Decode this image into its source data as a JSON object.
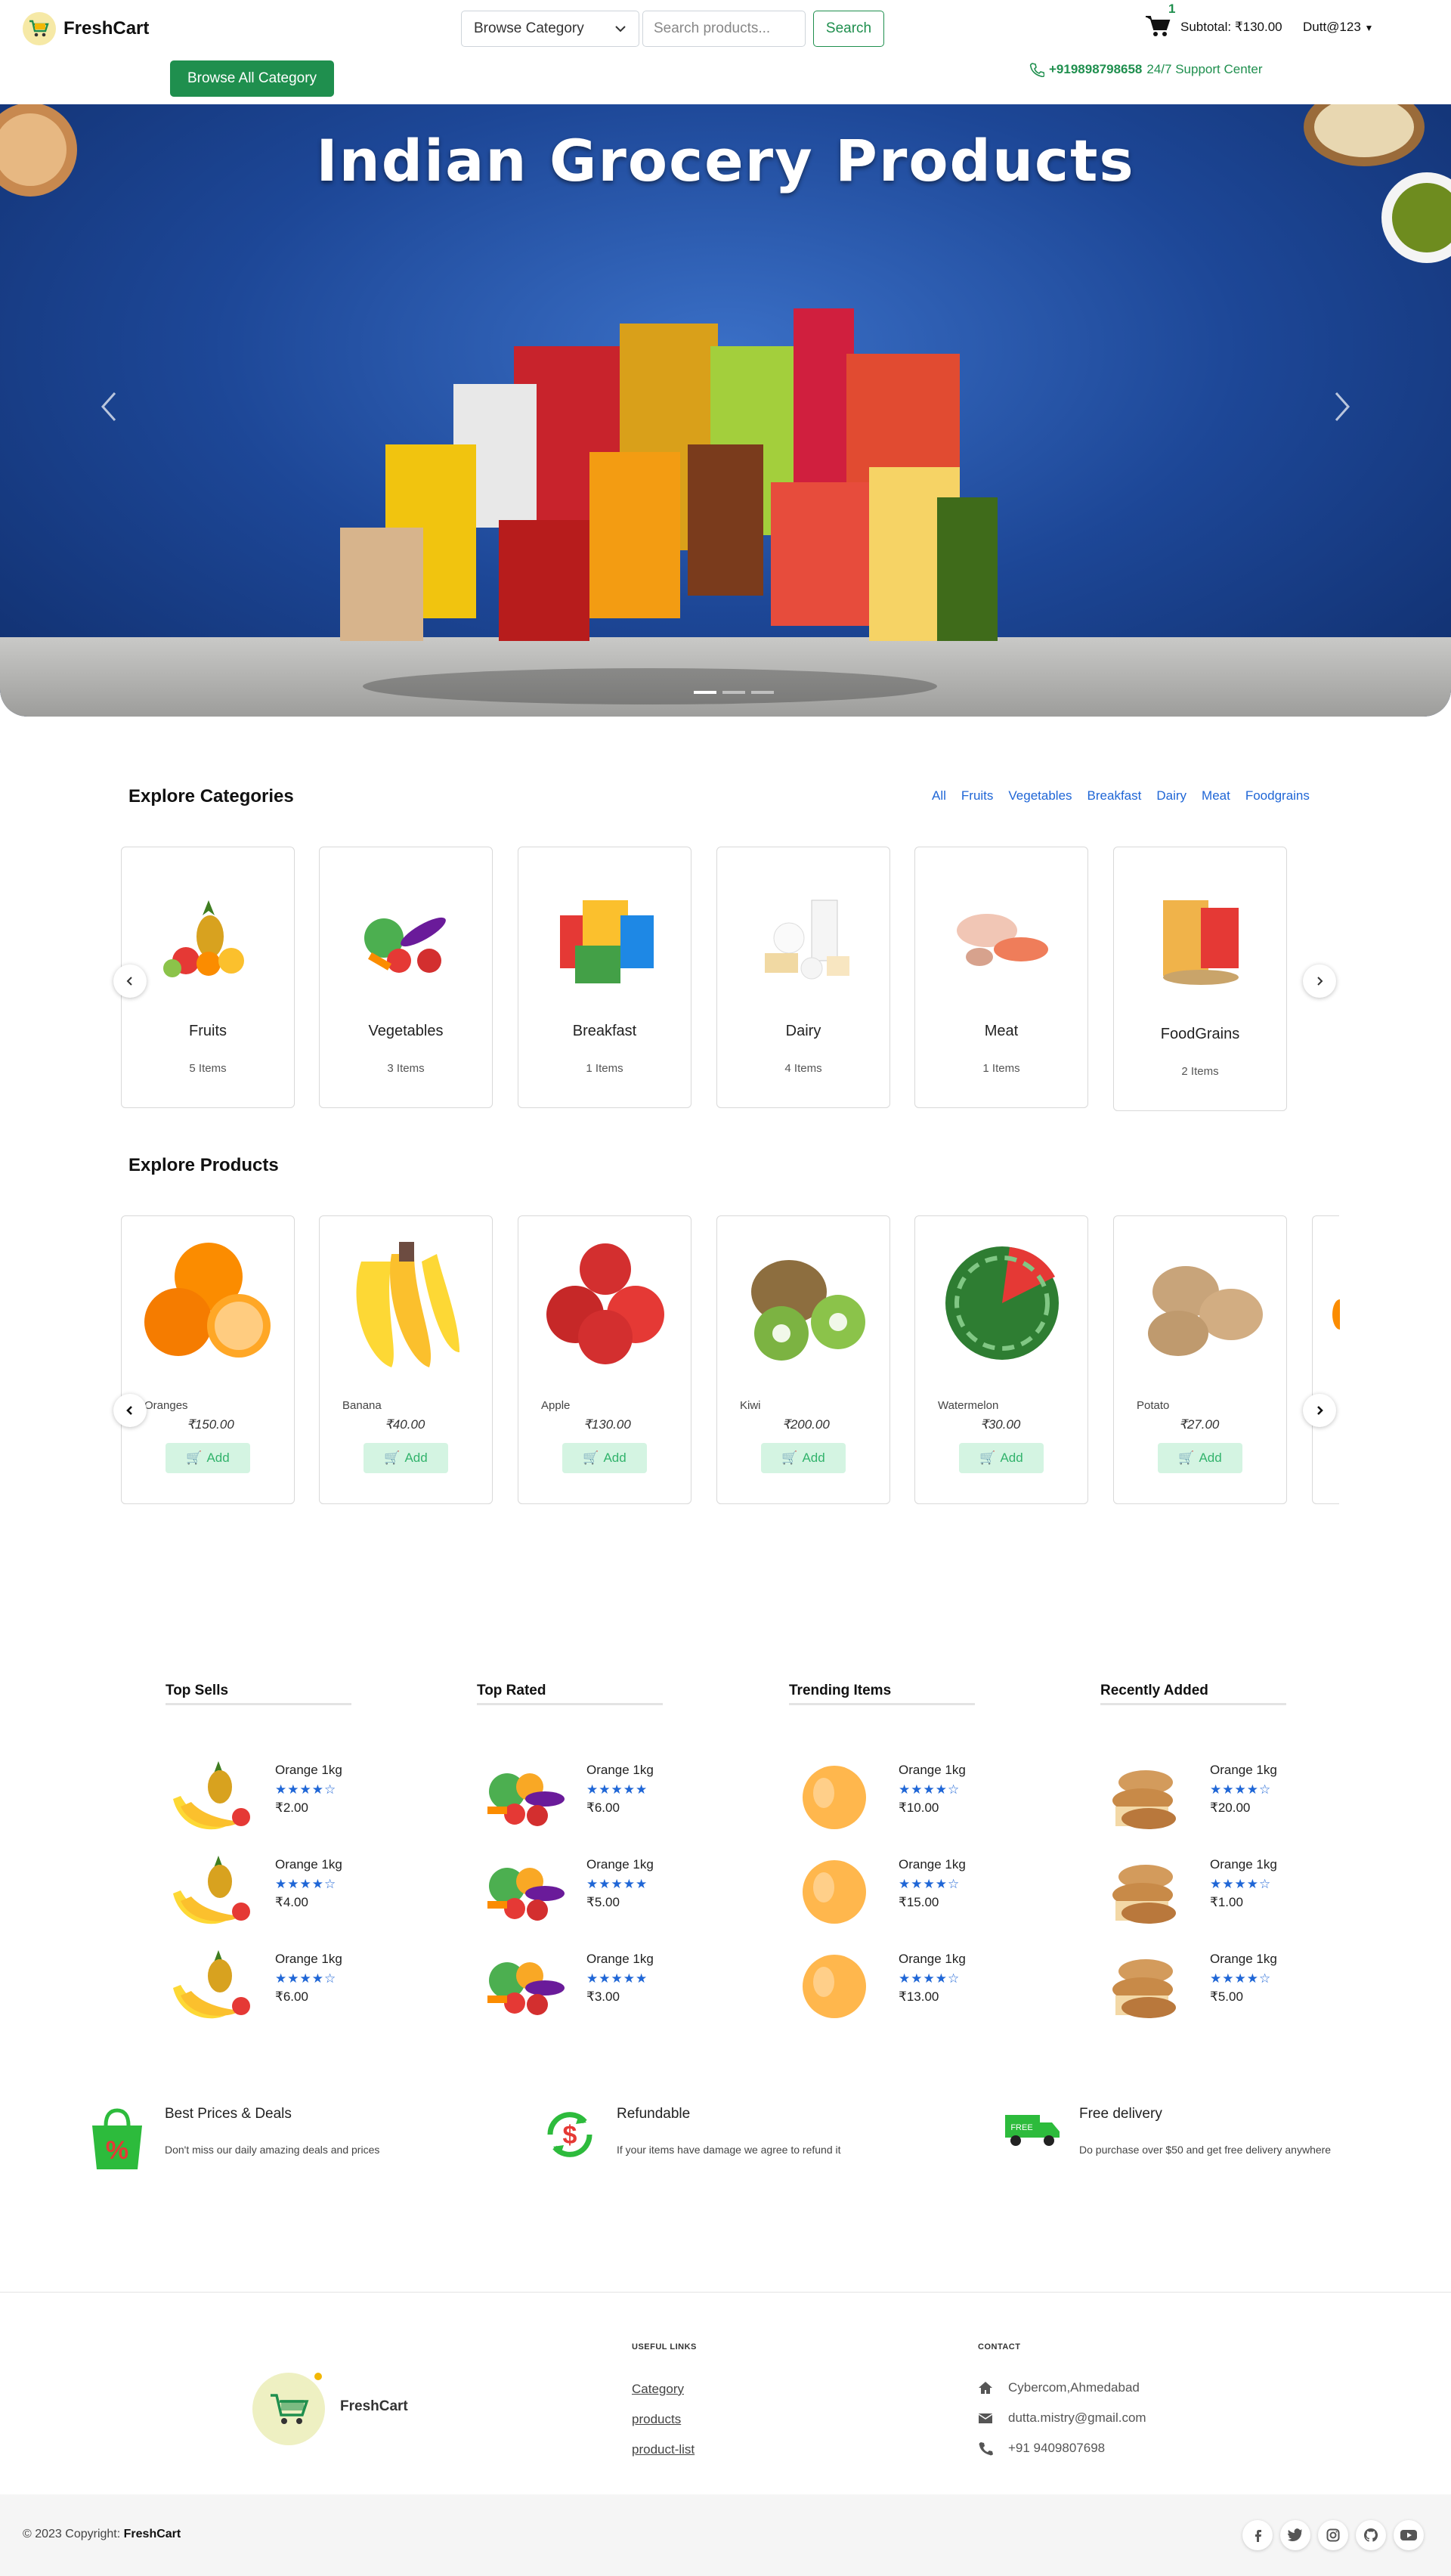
{
  "header": {
    "brand": "FreshCart",
    "category_select": "Browse Category",
    "search_placeholder": "Search products...",
    "search_button": "Search",
    "cart_count": "1",
    "subtotal": "Subtotal: ₹130.00",
    "user": "Dutt@123",
    "browse_all": "Browse All Category",
    "phone": "+919898798658",
    "support": "24/7 Support Center"
  },
  "hero": {
    "title": "Indian Grocery Products",
    "slides": 3,
    "active_slide": 1
  },
  "categories": {
    "title": "Explore Categories",
    "filters": [
      "All",
      "Fruits",
      "Vegetables",
      "Breakfast",
      "Dairy",
      "Meat",
      "Foodgrains"
    ],
    "items": [
      {
        "name": "Fruits",
        "count": "5 Items"
      },
      {
        "name": "Vegetables",
        "count": "3 Items"
      },
      {
        "name": "Breakfast",
        "count": "1 Items"
      },
      {
        "name": "Dairy",
        "count": "4 Items"
      },
      {
        "name": "Meat",
        "count": "1 Items"
      },
      {
        "name": "FoodGrains",
        "count": "2 Items"
      }
    ]
  },
  "products": {
    "title": "Explore Products",
    "add_label": "Add",
    "items": [
      {
        "name": "Oranges",
        "price": "₹150.00"
      },
      {
        "name": "Banana",
        "price": "₹40.00"
      },
      {
        "name": "Apple",
        "price": "₹130.00"
      },
      {
        "name": "Kiwi",
        "price": "₹200.00"
      },
      {
        "name": "Watermelon",
        "price": "₹30.00"
      },
      {
        "name": "Potato",
        "price": "₹27.00"
      }
    ]
  },
  "lists": [
    {
      "title": "Top Sells",
      "image": "banana-pineapple",
      "items": [
        {
          "name": "Orange 1kg",
          "rating": 4,
          "price": "₹2.00"
        },
        {
          "name": "Orange 1kg",
          "rating": 4,
          "price": "₹4.00"
        },
        {
          "name": "Orange 1kg",
          "rating": 4,
          "price": "₹6.00"
        }
      ]
    },
    {
      "title": "Top Rated",
      "image": "vegetables",
      "items": [
        {
          "name": "Orange 1kg",
          "rating": 5,
          "price": "₹6.00"
        },
        {
          "name": "Orange 1kg",
          "rating": 5,
          "price": "₹5.00"
        },
        {
          "name": "Orange 1kg",
          "rating": 5,
          "price": "₹3.00"
        }
      ]
    },
    {
      "title": "Trending Items",
      "image": "peach",
      "items": [
        {
          "name": "Orange 1kg",
          "rating": 4,
          "price": "₹10.00"
        },
        {
          "name": "Orange 1kg",
          "rating": 4,
          "price": "₹15.00"
        },
        {
          "name": "Orange 1kg",
          "rating": 4,
          "price": "₹13.00"
        }
      ]
    },
    {
      "title": "Recently Added",
      "image": "bread",
      "items": [
        {
          "name": "Orange 1kg",
          "rating": 4,
          "price": "₹20.00"
        },
        {
          "name": "Orange 1kg",
          "rating": 4,
          "price": "₹1.00"
        },
        {
          "name": "Orange 1kg",
          "rating": 4,
          "price": "₹5.00"
        }
      ]
    }
  ],
  "features": [
    {
      "title": "Best Prices & Deals",
      "desc": "Don't miss our daily amazing deals and prices",
      "icon": "shopping-bag-percent-icon"
    },
    {
      "title": "Refundable",
      "desc": "If your items have damage we agree to refund it",
      "icon": "refund-icon"
    },
    {
      "title": "Free delivery",
      "desc": "Do purchase over $50 and get free delivery anywhere",
      "icon": "delivery-truck-icon"
    }
  ],
  "footer": {
    "brand": "FreshCart",
    "useful_links_title": "USEFUL LINKS",
    "links": [
      "Category",
      "products",
      "product-list"
    ],
    "contact_title": "CONTACT",
    "address": "Cybercom,Ahmedabad",
    "email": "dutta.mistry@gmail.com",
    "phone": "+91 9409807698",
    "copyright_prefix": "© 2023 Copyright:",
    "copyright_brand": "FreshCart",
    "social": [
      "facebook-icon",
      "twitter-icon",
      "instagram-icon",
      "github-icon",
      "youtube-icon"
    ]
  },
  "colors": {
    "brand_green": "#1f8f4e",
    "link_blue": "#1f66d6",
    "hero_blue": "#1d4797"
  }
}
